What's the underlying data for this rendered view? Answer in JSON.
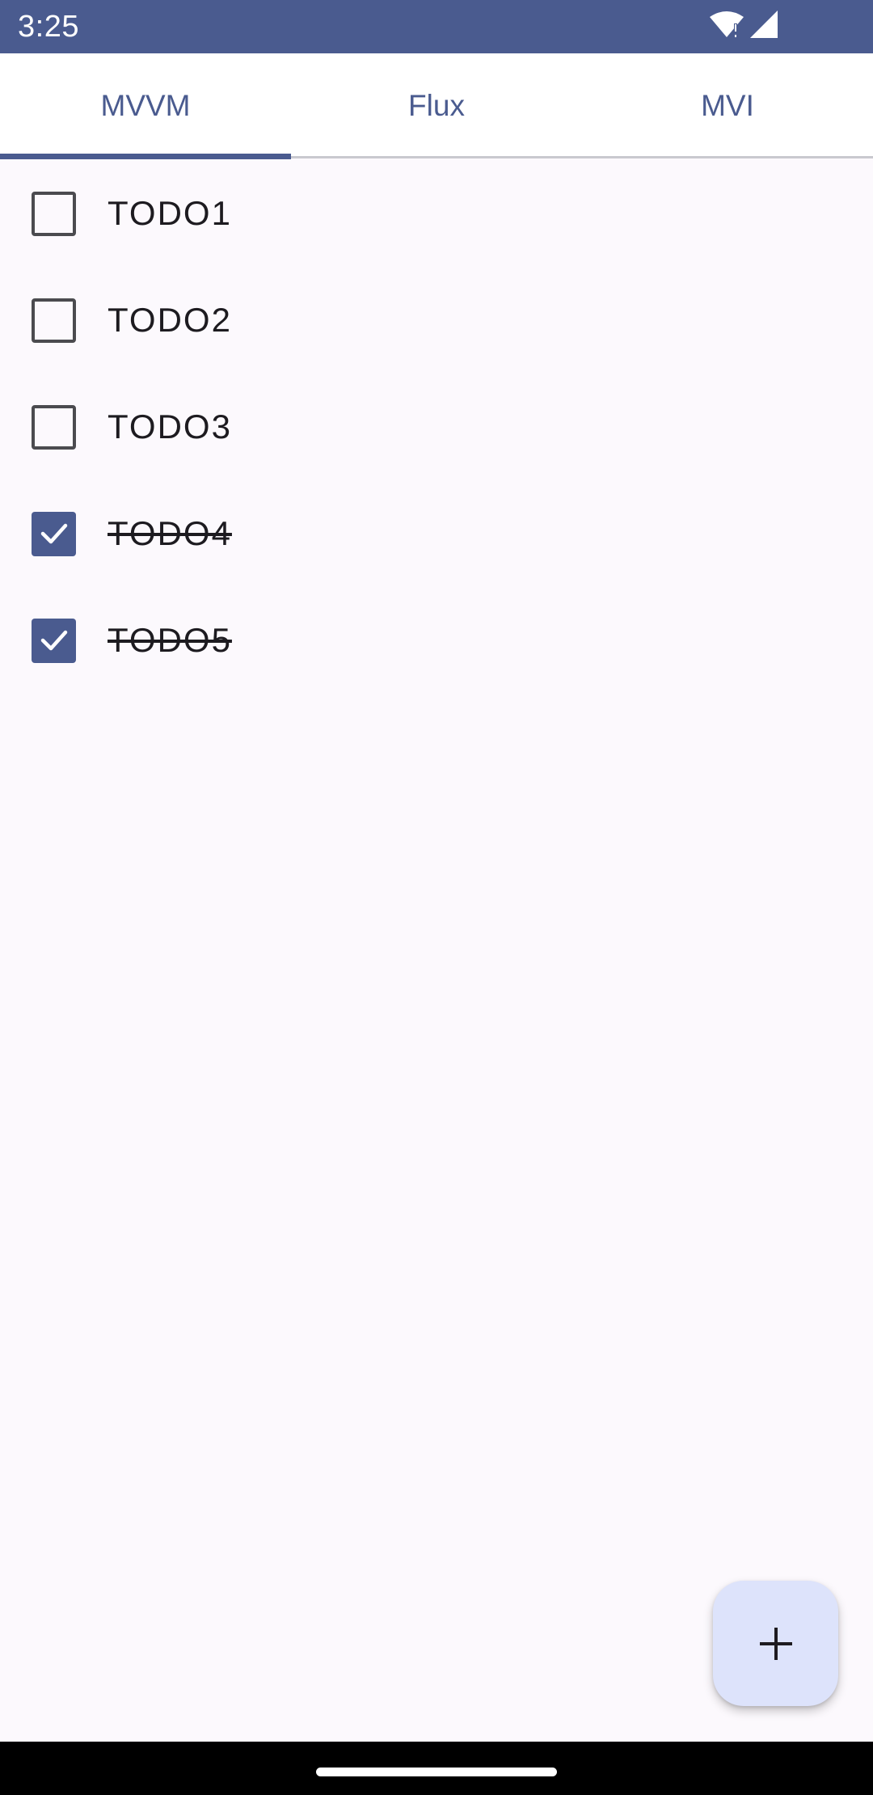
{
  "status_bar": {
    "time": "3:25",
    "icons": [
      "wifi-alert-icon",
      "cell-signal-icon"
    ]
  },
  "tabs": [
    {
      "label": "MVVM",
      "selected": true
    },
    {
      "label": "Flux",
      "selected": false
    },
    {
      "label": "MVI",
      "selected": false
    }
  ],
  "todos": [
    {
      "label": "TODO1",
      "done": false
    },
    {
      "label": "TODO2",
      "done": false
    },
    {
      "label": "TODO3",
      "done": false
    },
    {
      "label": "TODO4",
      "done": true
    },
    {
      "label": "TODO5",
      "done": true
    }
  ],
  "fab": {
    "icon": "plus-icon"
  },
  "colors": {
    "primary": "#4a5b8f",
    "background": "#fcf9fd",
    "fab_container": "#dde3fb",
    "text": "#1d1b20"
  }
}
